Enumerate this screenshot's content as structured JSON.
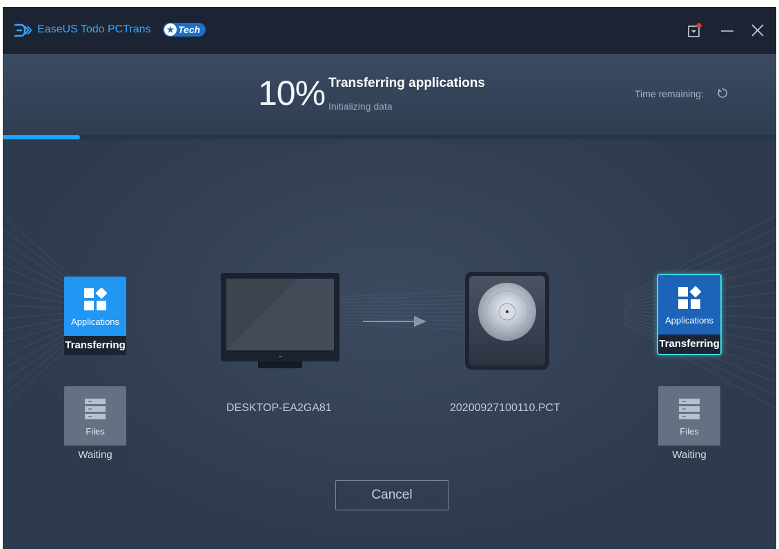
{
  "window": {
    "app_name": "EaseUS Todo PCTrans",
    "edition_badge": "Tech",
    "icons": [
      "app-logo-icon",
      "star-icon",
      "feedback-icon",
      "minimize-icon",
      "close-icon"
    ]
  },
  "header": {
    "percent_text": "10%",
    "progress_fraction": 0.1,
    "title": "Transferring applications",
    "subtitle": "Initializing data",
    "time_remaining_label": "Time remaining:",
    "time_remaining_icon": "loading-spinner-icon"
  },
  "source": {
    "device_name": "DESKTOP-EA2GA81",
    "icon": "monitor-icon",
    "items": [
      {
        "label": "Applications",
        "status": "Transferring",
        "icon": "applications-icon"
      },
      {
        "label": "Files",
        "status": "Waiting",
        "icon": "files-icon"
      }
    ]
  },
  "destination": {
    "device_name": "20200927100110.PCT",
    "icon": "image-file-disk-icon",
    "items": [
      {
        "label": "Applications",
        "status": "Transferring",
        "icon": "applications-icon"
      },
      {
        "label": "Files",
        "status": "Waiting",
        "icon": "files-icon"
      }
    ]
  },
  "actions": {
    "cancel_label": "Cancel"
  },
  "colors": {
    "titlebar": "#1c2434",
    "accent": "#2196f3",
    "progress": "#1aa7ff",
    "active_glow": "#3fd6e0",
    "waiting_tile": "#647182"
  }
}
